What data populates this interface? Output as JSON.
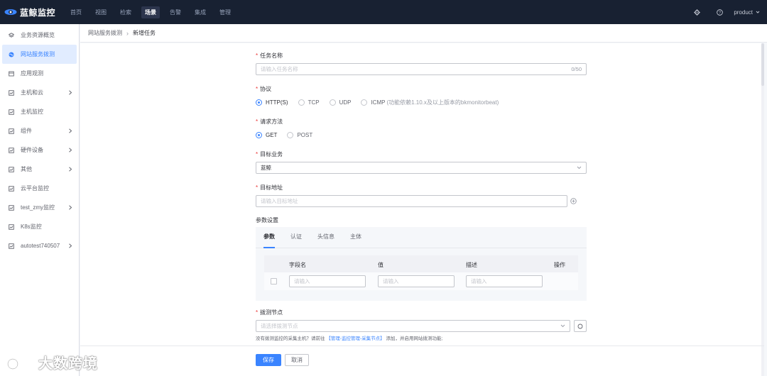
{
  "app": {
    "logo_text": "蓝鲸监控",
    "nav": [
      "首页",
      "视图",
      "检索",
      "场景",
      "告警",
      "集成",
      "管理"
    ],
    "nav_active": 3,
    "user": "product"
  },
  "sidebar": {
    "items": [
      {
        "label": "业务资源概览",
        "icon": "layers-icon",
        "chevron": false
      },
      {
        "label": "网站服务拨测",
        "icon": "globe-icon",
        "chevron": false,
        "active": true
      },
      {
        "label": "应用观测",
        "icon": "app-icon",
        "chevron": false
      },
      {
        "label": "主机和云",
        "icon": "monitor-icon",
        "chevron": true
      },
      {
        "label": "主机监控",
        "icon": "monitor-icon",
        "chevron": false
      },
      {
        "label": "组件",
        "icon": "monitor-icon",
        "chevron": true
      },
      {
        "label": "硬件设备",
        "icon": "monitor-icon",
        "chevron": true
      },
      {
        "label": "其他",
        "icon": "monitor-icon",
        "chevron": true
      },
      {
        "label": "云平台监控",
        "icon": "monitor-icon",
        "chevron": false
      },
      {
        "label": "test_zmy监控",
        "icon": "monitor-icon",
        "chevron": true
      },
      {
        "label": "K8s监控",
        "icon": "monitor-icon",
        "chevron": false
      },
      {
        "label": "autotest740507",
        "icon": "monitor-icon",
        "chevron": true
      }
    ]
  },
  "breadcrumb": {
    "parent": "网站服务拨测",
    "sep": "›",
    "current": "新增任务"
  },
  "form": {
    "task_name": {
      "label": "任务名称",
      "placeholder": "请输入任务名称",
      "count": "0/50"
    },
    "protocol": {
      "label": "协议",
      "options": [
        {
          "label": "HTTP(S)",
          "checked": true,
          "note": ""
        },
        {
          "label": "TCP",
          "checked": false,
          "note": ""
        },
        {
          "label": "UDP",
          "checked": false,
          "note": ""
        },
        {
          "label": "ICMP",
          "checked": false,
          "note": "(功能依赖1.10.x及以上版本的bkmonitorbeat)"
        }
      ]
    },
    "method": {
      "label": "请求方法",
      "options": [
        {
          "label": "GET",
          "checked": true
        },
        {
          "label": "POST",
          "checked": false
        }
      ]
    },
    "biz": {
      "label": "目标业务",
      "value": "蓝鲸"
    },
    "target": {
      "label": "目标地址",
      "placeholder": "请输入目标地址"
    },
    "params": {
      "label": "参数设置",
      "tabs": [
        "参数",
        "认证",
        "头信息",
        "主体"
      ],
      "active_tab": 0,
      "columns": [
        "字段名",
        "值",
        "描述",
        "操作"
      ],
      "row_placeholder": "请输入"
    },
    "nodes": {
      "label": "拨测节点",
      "placeholder": "请选择拨测节点",
      "tip_before": "没有拨测监控的采集主机？请前往",
      "tip_link": "【管理-监控管理-采集节点】",
      "tip_after": "添加，并启用网站拨测功能;"
    },
    "save_label": "保存",
    "cancel_label": "取消"
  },
  "watermark": "大数跨境"
}
